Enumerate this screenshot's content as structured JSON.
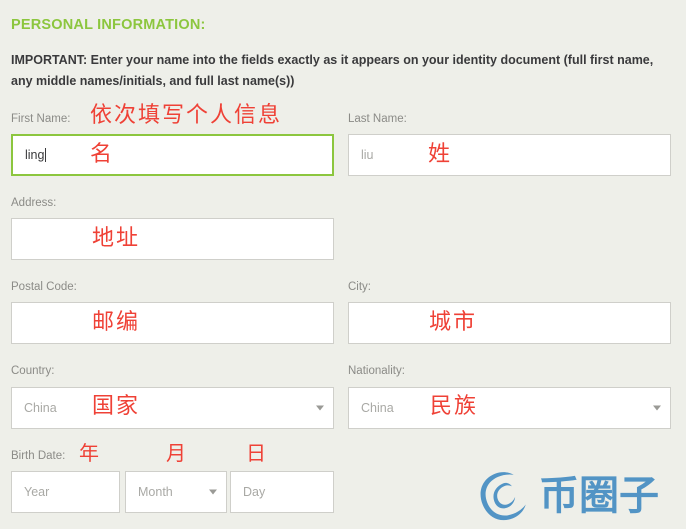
{
  "section": {
    "title": "PERSONAL INFORMATION:",
    "title_color": "#8cc63e",
    "important_note": "IMPORTANT: Enter your name into the fields exactly as it appears on your identity document (full first name, any middle names/initials, and full last name(s))"
  },
  "fields": {
    "first_name": {
      "label": "First Name:",
      "value": "ling",
      "placeholder": "",
      "focused": true,
      "annotation_label": "依次填写个人信息",
      "annotation_field": "名"
    },
    "last_name": {
      "label": "Last Name:",
      "value": "",
      "placeholder": "liu",
      "focused": false,
      "annotation_field": "姓"
    },
    "address": {
      "label": "Address:",
      "value": "",
      "placeholder": "",
      "annotation_field": "地址"
    },
    "postal_code": {
      "label": "Postal Code:",
      "value": "",
      "placeholder": "",
      "annotation_field": "邮编"
    },
    "city": {
      "label": "City:",
      "value": "",
      "placeholder": "",
      "annotation_field": "城市"
    },
    "country": {
      "label": "Country:",
      "selected": "China",
      "annotation_field": "国家"
    },
    "nationality": {
      "label": "Nationality:",
      "selected": "China",
      "annotation_field": "民族"
    },
    "birth_date": {
      "label": "Birth Date:",
      "year_placeholder": "Year",
      "month_placeholder": "Month",
      "day_placeholder": "Day",
      "annotation_year": "年",
      "annotation_month": "月",
      "annotation_day": "日"
    }
  },
  "watermark": {
    "text": "币圈子",
    "color": "#4a90c4"
  },
  "colors": {
    "background": "#eeefe9",
    "accent_green": "#8cc63e",
    "annotation_red": "#ef4136",
    "label_gray": "#8b8b87",
    "text_dark": "#3a3a3c",
    "border_gray": "#cfcfca",
    "placeholder_gray": "#a9a9a5"
  }
}
